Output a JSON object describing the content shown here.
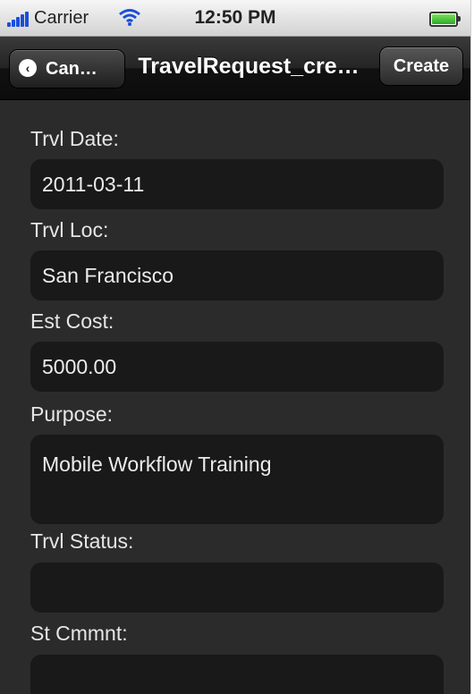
{
  "status_bar": {
    "carrier": "Carrier",
    "time": "12:50 PM",
    "icons": [
      "signal-bars-icon",
      "wifi-icon",
      "battery-icon"
    ]
  },
  "nav_bar": {
    "back_label": "Can…",
    "title": "TravelRequest_cre…",
    "create_label": "Create"
  },
  "form": {
    "fields": [
      {
        "label": "Trvl Date:",
        "value": "2011-03-11"
      },
      {
        "label": "Trvl Loc:",
        "value": "San Francisco"
      },
      {
        "label": "Est Cost:",
        "value": "5000.00"
      },
      {
        "label": "Purpose:",
        "value": "Mobile Workflow Training"
      },
      {
        "label": "Trvl Status:",
        "value": ""
      },
      {
        "label": "St Cmmnt:",
        "value": ""
      }
    ]
  },
  "colors": {
    "background": "#2b2b2b",
    "field_background": "#191919",
    "label_text": "#e6e6e6",
    "signal_blue": "#1a4fd8",
    "battery_green": "#3bc83b"
  }
}
